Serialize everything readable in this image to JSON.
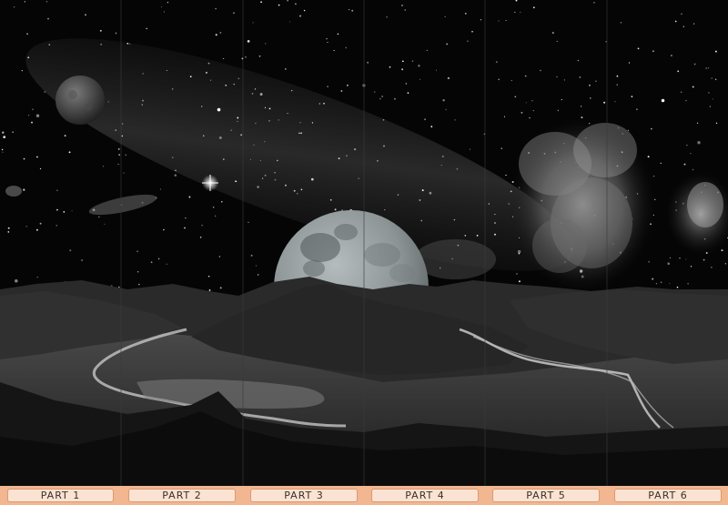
{
  "panels": [
    {
      "label": "PART 1"
    },
    {
      "label": "PART 2"
    },
    {
      "label": "PART 3"
    },
    {
      "label": "PART 4"
    },
    {
      "label": "PART 5"
    },
    {
      "label": "PART 6"
    }
  ],
  "colors": {
    "label_bar": "#f2b790",
    "label_fill": "#fbe3d3",
    "label_border": "#d89a76",
    "sky": "#050505",
    "moon": "#8f9698"
  },
  "scene": {
    "style": "grayscale night sky over mountain valley",
    "icons": [
      "full-moon",
      "small-planet",
      "bright-star",
      "nebula",
      "milky-way",
      "river"
    ]
  }
}
